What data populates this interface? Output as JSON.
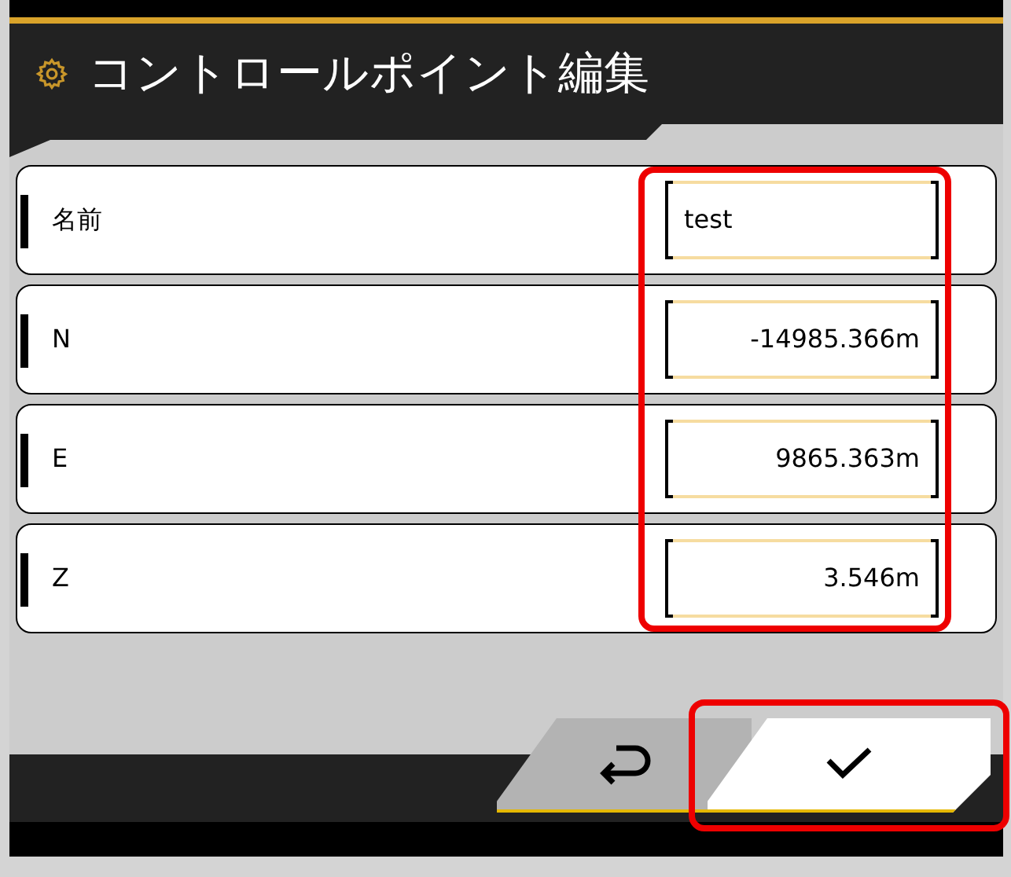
{
  "header": {
    "title": "コントロールポイント編集"
  },
  "fields_highlighted": true,
  "fields": [
    {
      "label": "名前",
      "value": "test",
      "kind": "text"
    },
    {
      "label": "N",
      "value": "-14985.366m",
      "kind": "number"
    },
    {
      "label": "E",
      "value": "9865.363m",
      "kind": "number"
    },
    {
      "label": "Z",
      "value": "3.546m",
      "kind": "number"
    }
  ],
  "buttons": [
    {
      "kind": "back",
      "highlighted": false
    },
    {
      "kind": "confirm",
      "highlighted": true
    }
  ]
}
